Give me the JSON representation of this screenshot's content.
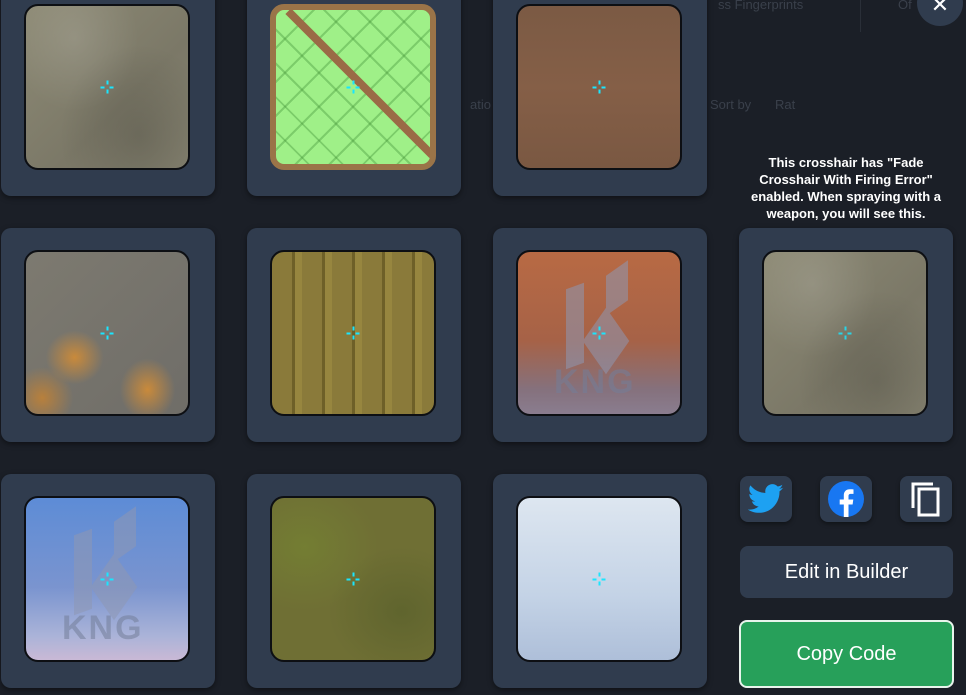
{
  "background_text": {
    "top_right_a": "ss Fingerprints",
    "top_right_b": "Of",
    "middle_a": "atio",
    "middle_b": "Sort by",
    "middle_c": "Rat"
  },
  "close_icon": "✕",
  "previews": [
    {
      "texture": "plaster-wall"
    },
    {
      "texture": "green-glass-tiles"
    },
    {
      "texture": "brown-wood"
    },
    {
      "texture": "chipped-paint-wall"
    },
    {
      "texture": "wooden-planks"
    },
    {
      "texture": "orange-wall-kng-logo",
      "logo_text": "KNG"
    },
    {
      "texture": "plaster-wall-spray-preview"
    },
    {
      "texture": "blue-wall-kng-logo",
      "logo_text": "KNG"
    },
    {
      "texture": "mossy-ground"
    },
    {
      "texture": "cloudy-sky"
    }
  ],
  "fade_note": "This crosshair has \"Fade Crosshair With Firing Error\" enabled. When spraying with a weapon, you will see this.",
  "share": {
    "twitter_icon": "twitter-icon",
    "facebook_icon": "facebook-icon",
    "copy_icon": "copy-icon"
  },
  "buttons": {
    "edit_label": "Edit in Builder",
    "copy_label": "Copy Code"
  },
  "colors": {
    "crosshair": "#19e6ff",
    "tile": "#303c4e",
    "copy_button": "#27a05a",
    "twitter": "#1da1f2",
    "facebook": "#1877f2"
  }
}
